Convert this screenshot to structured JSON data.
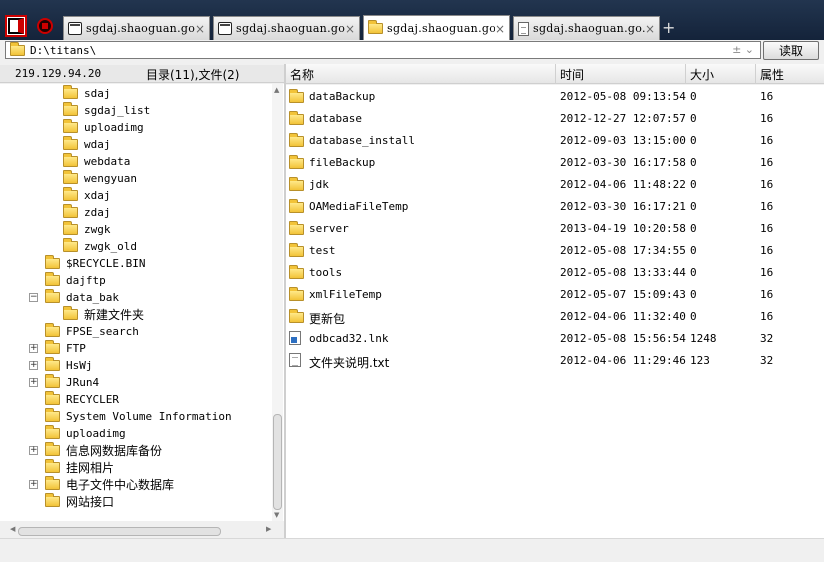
{
  "tabs": [
    {
      "label": "sgdaj.shaoguan.go...",
      "icon": "terminal-icon",
      "active": false
    },
    {
      "label": "sgdaj.shaoguan.go...",
      "icon": "terminal-icon",
      "active": false
    },
    {
      "label": "sgdaj.shaoguan.go...",
      "icon": "folder-icon",
      "active": true
    },
    {
      "label": "sgdaj.shaoguan.go...",
      "icon": "document-icon",
      "active": false
    }
  ],
  "tab_close": "×",
  "new_tab": "+",
  "path": {
    "value": "D:\\titans\\",
    "controls": "±  ⌄"
  },
  "read_button": "读取",
  "info": {
    "ip": "219.129.94.20",
    "counts": "目录(11),文件(2)"
  },
  "columns": {
    "name": "名称",
    "time": "时间",
    "size": "大小",
    "attr": "属性"
  },
  "tree": [
    {
      "label": "sdaj",
      "level": 3,
      "expander": ""
    },
    {
      "label": "sgdaj_list",
      "level": 3,
      "expander": ""
    },
    {
      "label": "uploadimg",
      "level": 3,
      "expander": ""
    },
    {
      "label": "wdaj",
      "level": 3,
      "expander": ""
    },
    {
      "label": "webdata",
      "level": 3,
      "expander": ""
    },
    {
      "label": "wengyuan",
      "level": 3,
      "expander": ""
    },
    {
      "label": "xdaj",
      "level": 3,
      "expander": ""
    },
    {
      "label": "zdaj",
      "level": 3,
      "expander": ""
    },
    {
      "label": "zwgk",
      "level": 3,
      "expander": ""
    },
    {
      "label": "zwgk_old",
      "level": 3,
      "expander": ""
    },
    {
      "label": "$RECYCLE.BIN",
      "level": 2,
      "expander": ""
    },
    {
      "label": "dajftp",
      "level": 2,
      "expander": ""
    },
    {
      "label": "data_bak",
      "level": 2,
      "expander": "−"
    },
    {
      "label": "新建文件夹",
      "level": 3,
      "expander": ""
    },
    {
      "label": "FPSE_search",
      "level": 2,
      "expander": ""
    },
    {
      "label": "FTP",
      "level": 2,
      "expander": "+"
    },
    {
      "label": "HsWj",
      "level": 2,
      "expander": "+"
    },
    {
      "label": "JRun4",
      "level": 2,
      "expander": "+"
    },
    {
      "label": "RECYCLER",
      "level": 2,
      "expander": ""
    },
    {
      "label": "System Volume Information",
      "level": 2,
      "expander": ""
    },
    {
      "label": "uploadimg",
      "level": 2,
      "expander": ""
    },
    {
      "label": "信息网数据库备份",
      "level": 2,
      "expander": "+"
    },
    {
      "label": "挂网相片",
      "level": 2,
      "expander": ""
    },
    {
      "label": "电子文件中心数据库",
      "level": 2,
      "expander": "+"
    },
    {
      "label": "网站接口",
      "level": 2,
      "expander": ""
    }
  ],
  "files": [
    {
      "name": "dataBackup",
      "time": "2012-05-08 09:13:54",
      "size": "0",
      "attr": "16",
      "icon": "folder-icon"
    },
    {
      "name": "database",
      "time": "2012-12-27 12:07:57",
      "size": "0",
      "attr": "16",
      "icon": "folder-icon"
    },
    {
      "name": "database_install",
      "time": "2012-09-03 13:15:00",
      "size": "0",
      "attr": "16",
      "icon": "folder-icon"
    },
    {
      "name": "fileBackup",
      "time": "2012-03-30 16:17:58",
      "size": "0",
      "attr": "16",
      "icon": "folder-icon"
    },
    {
      "name": "jdk",
      "time": "2012-04-06 11:48:22",
      "size": "0",
      "attr": "16",
      "icon": "folder-icon"
    },
    {
      "name": "OAMediaFileTemp",
      "time": "2012-03-30 16:17:21",
      "size": "0",
      "attr": "16",
      "icon": "folder-icon"
    },
    {
      "name": "server",
      "time": "2013-04-19 10:20:58",
      "size": "0",
      "attr": "16",
      "icon": "folder-icon"
    },
    {
      "name": "test",
      "time": "2012-05-08 17:34:55",
      "size": "0",
      "attr": "16",
      "icon": "folder-icon"
    },
    {
      "name": "tools",
      "time": "2012-05-08 13:33:44",
      "size": "0",
      "attr": "16",
      "icon": "folder-icon"
    },
    {
      "name": "xmlFileTemp",
      "time": "2012-05-07 15:09:43",
      "size": "0",
      "attr": "16",
      "icon": "folder-icon"
    },
    {
      "name": "更新包",
      "time": "2012-04-06 11:32:40",
      "size": "0",
      "attr": "16",
      "icon": "folder-icon"
    },
    {
      "name": "odbcad32.lnk",
      "time": "2012-05-08 15:56:54",
      "size": "1248",
      "attr": "32",
      "icon": "shortcut-icon"
    },
    {
      "name": "文件夹说明.txt",
      "time": "2012-04-06 11:29:46",
      "size": "123",
      "attr": "32",
      "icon": "text-file-icon"
    }
  ]
}
